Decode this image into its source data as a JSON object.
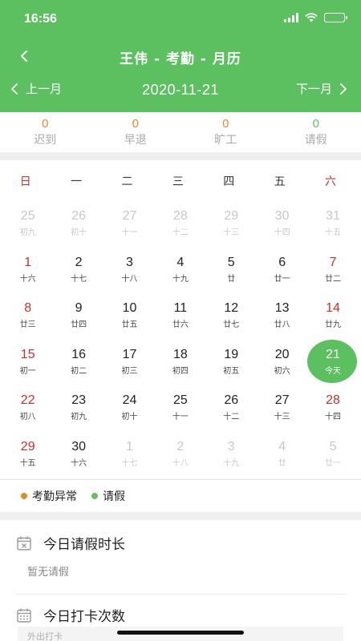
{
  "status_bar": {
    "time": "16:56"
  },
  "header": {
    "title": "王伟 - 考勤 - 月历"
  },
  "month_nav": {
    "prev_label": "上一月",
    "current": "2020-11-21",
    "next_label": "下一月"
  },
  "stats": [
    {
      "value": "0",
      "label": "迟到",
      "color": "#e08a2e"
    },
    {
      "value": "0",
      "label": "早退",
      "color": "#e08a2e"
    },
    {
      "value": "0",
      "label": "旷工",
      "color": "#e08a2e"
    },
    {
      "value": "0",
      "label": "请假",
      "color": "#5cbf60"
    }
  ],
  "weekdays": [
    "日",
    "一",
    "二",
    "三",
    "四",
    "五",
    "六"
  ],
  "calendar": [
    [
      {
        "d": "25",
        "l": "初九",
        "other": true
      },
      {
        "d": "26",
        "l": "初十",
        "other": true
      },
      {
        "d": "27",
        "l": "十一",
        "other": true
      },
      {
        "d": "28",
        "l": "十二",
        "other": true
      },
      {
        "d": "29",
        "l": "十三",
        "other": true
      },
      {
        "d": "30",
        "l": "十四",
        "other": true
      },
      {
        "d": "31",
        "l": "十五",
        "other": true
      }
    ],
    [
      {
        "d": "1",
        "l": "十六"
      },
      {
        "d": "2",
        "l": "十七"
      },
      {
        "d": "3",
        "l": "十八"
      },
      {
        "d": "4",
        "l": "十九"
      },
      {
        "d": "5",
        "l": "廿"
      },
      {
        "d": "6",
        "l": "廿一"
      },
      {
        "d": "7",
        "l": "廿二"
      }
    ],
    [
      {
        "d": "8",
        "l": "廿三"
      },
      {
        "d": "9",
        "l": "廿四"
      },
      {
        "d": "10",
        "l": "廿五"
      },
      {
        "d": "11",
        "l": "廿六"
      },
      {
        "d": "12",
        "l": "廿七"
      },
      {
        "d": "13",
        "l": "廿八"
      },
      {
        "d": "14",
        "l": "廿九"
      }
    ],
    [
      {
        "d": "15",
        "l": "初一"
      },
      {
        "d": "16",
        "l": "初二"
      },
      {
        "d": "17",
        "l": "初三"
      },
      {
        "d": "18",
        "l": "初四"
      },
      {
        "d": "19",
        "l": "初五"
      },
      {
        "d": "20",
        "l": "初六"
      },
      {
        "d": "21",
        "l": "今天",
        "today": true
      }
    ],
    [
      {
        "d": "22",
        "l": "初八"
      },
      {
        "d": "23",
        "l": "初九"
      },
      {
        "d": "24",
        "l": "初十"
      },
      {
        "d": "25",
        "l": "十一"
      },
      {
        "d": "26",
        "l": "十二"
      },
      {
        "d": "27",
        "l": "十三"
      },
      {
        "d": "28",
        "l": "十四"
      }
    ],
    [
      {
        "d": "29",
        "l": "十五"
      },
      {
        "d": "30",
        "l": "十六"
      },
      {
        "d": "1",
        "l": "十七",
        "other": true
      },
      {
        "d": "2",
        "l": "十八",
        "other": true
      },
      {
        "d": "3",
        "l": "十九",
        "other": true
      },
      {
        "d": "4",
        "l": "廿",
        "other": true
      },
      {
        "d": "5",
        "l": "廿一",
        "other": true
      }
    ]
  ],
  "legend": [
    {
      "label": "考勤异常",
      "color": "#e08a2e"
    },
    {
      "label": "请假",
      "color": "#6cbf5f"
    }
  ],
  "leave_section": {
    "title": "今日请假时长",
    "empty_text": "暂无请假"
  },
  "punch_section": {
    "title": "今日打卡次数",
    "row_label": "外出打卡"
  },
  "colors": {
    "primary": "#5cbf60",
    "weekend": "#c62f2f",
    "background_gap": "#efefef"
  }
}
